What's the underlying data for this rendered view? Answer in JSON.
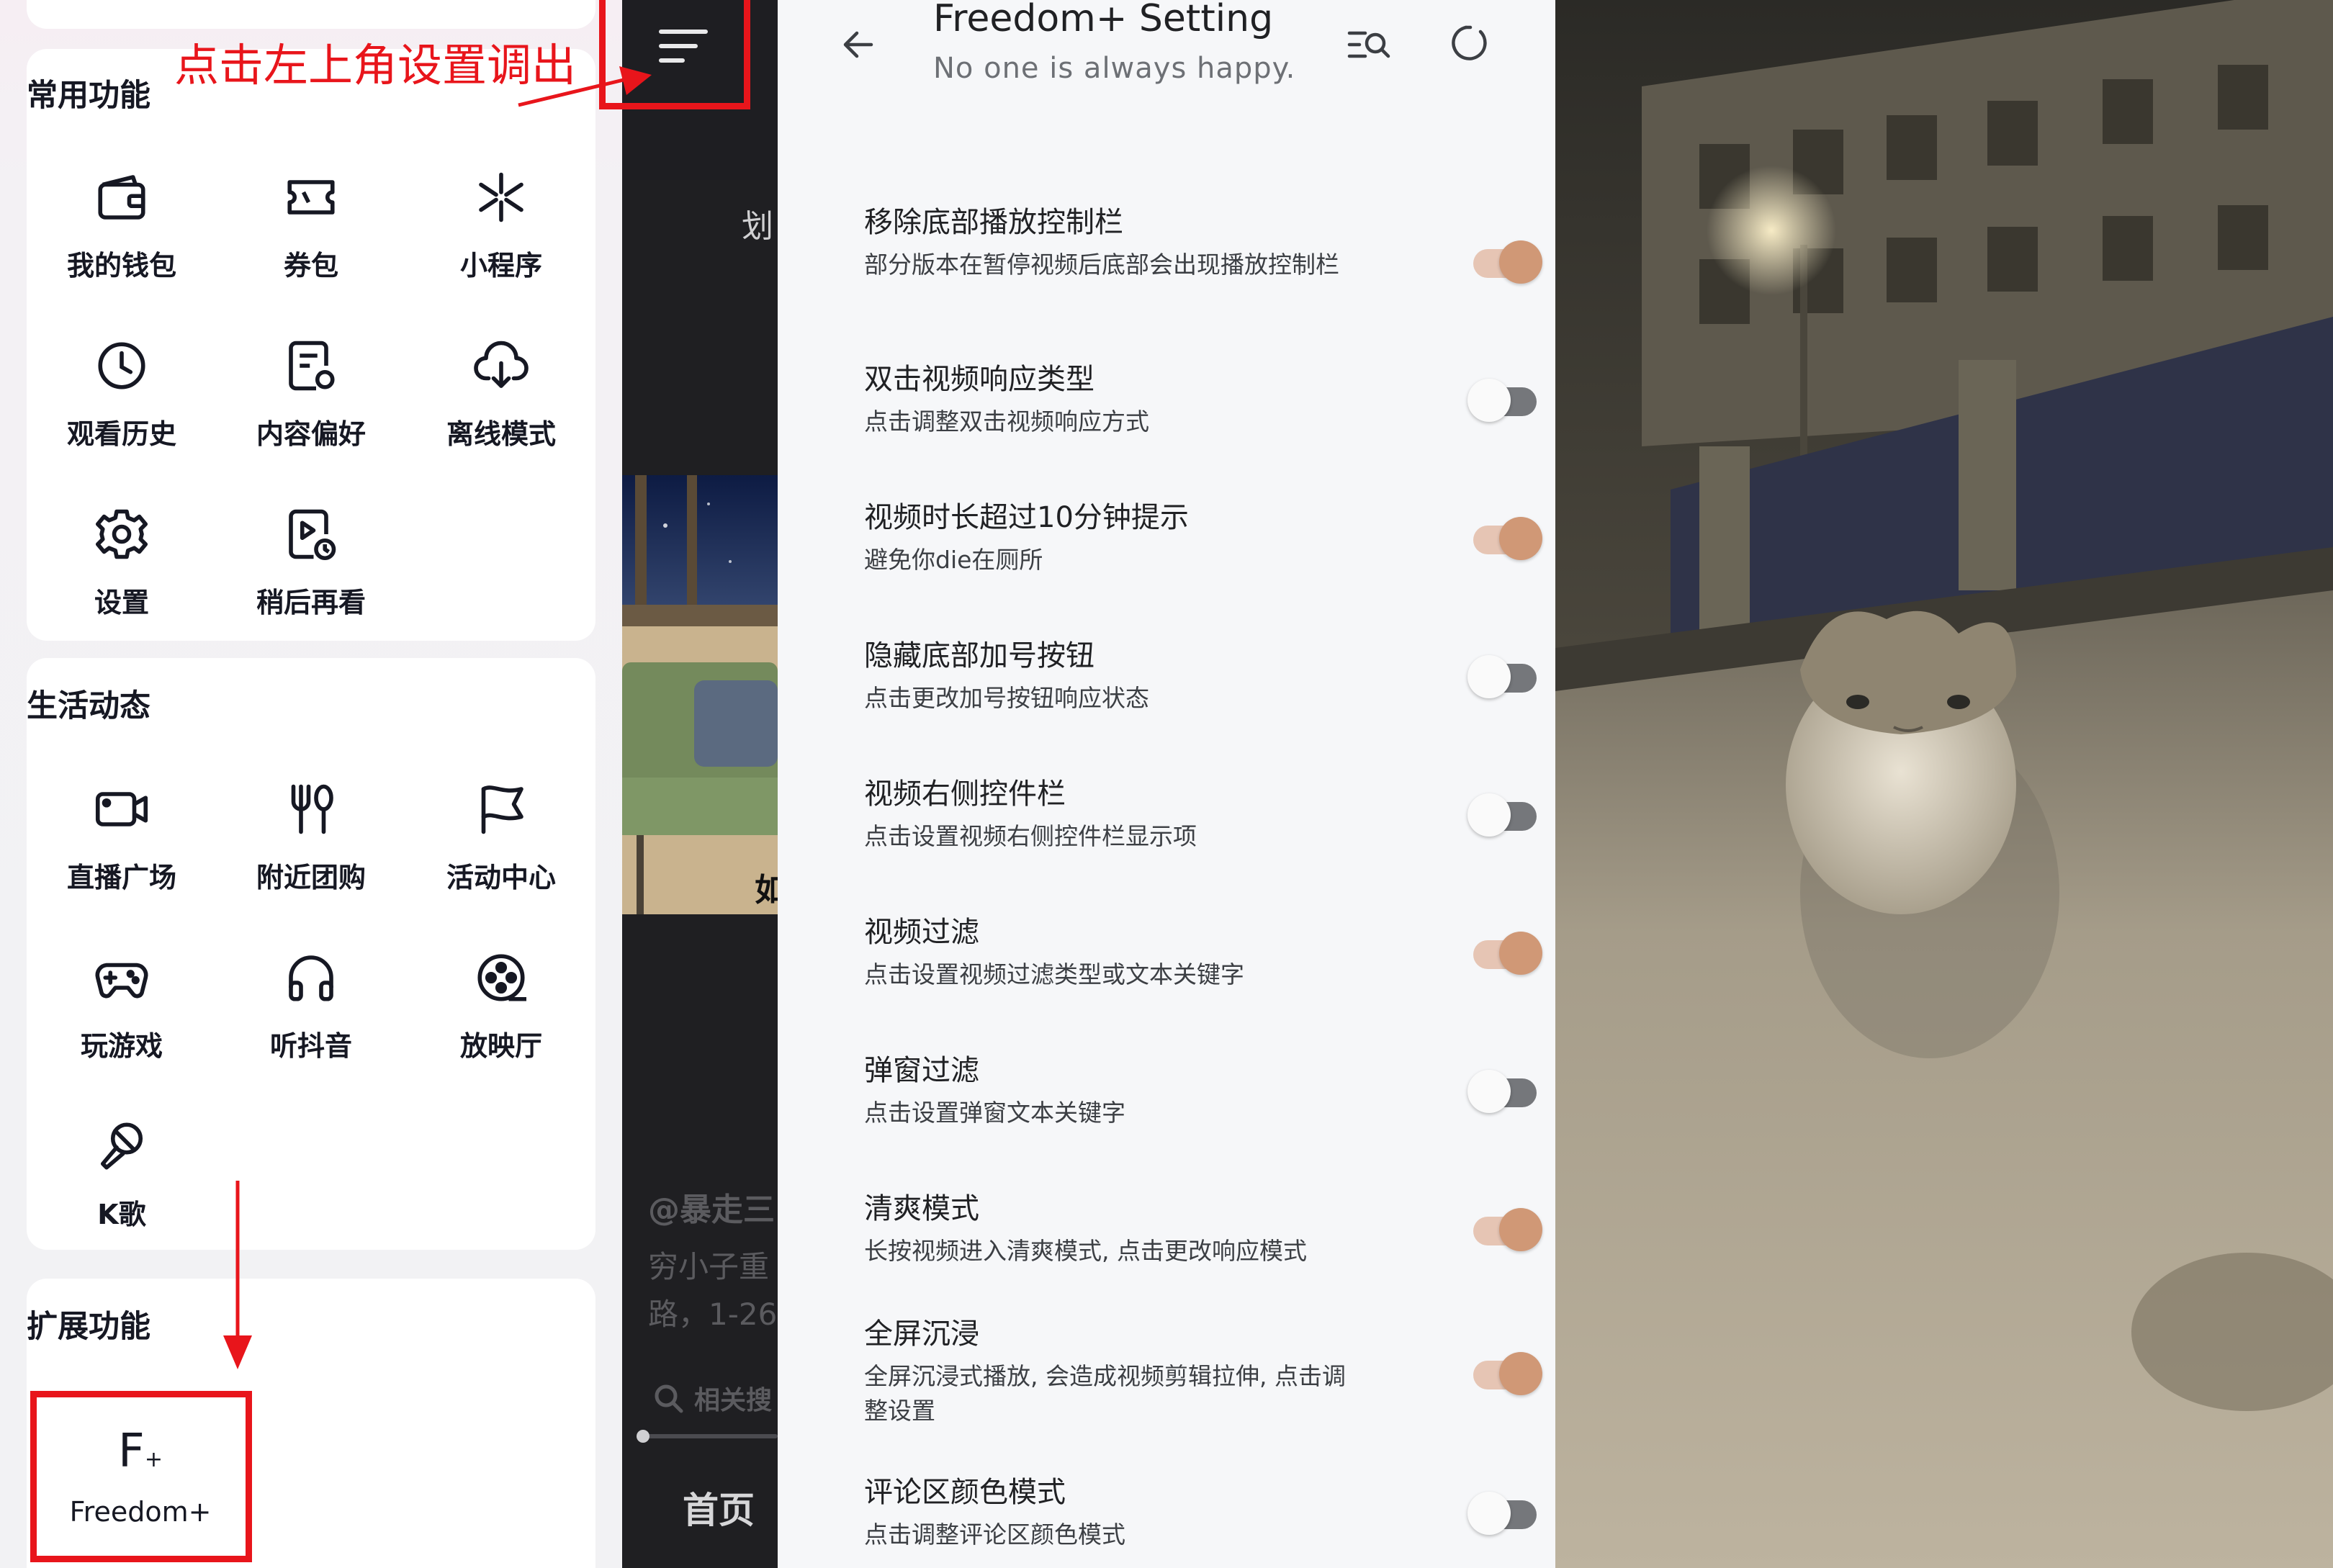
{
  "menu": {
    "sections": [
      {
        "title": "常用功能",
        "items": [
          {
            "label": "我的钱包",
            "icon": "wallet-icon"
          },
          {
            "label": "券包",
            "icon": "coupon-icon"
          },
          {
            "label": "小程序",
            "icon": "mini-program-icon"
          },
          {
            "label": "观看历史",
            "icon": "clock-icon"
          },
          {
            "label": "内容偏好",
            "icon": "preference-icon"
          },
          {
            "label": "离线模式",
            "icon": "cloud-download-icon"
          },
          {
            "label": "设置",
            "icon": "gear-icon"
          },
          {
            "label": "稍后再看",
            "icon": "watch-later-icon"
          }
        ]
      },
      {
        "title": "生活动态",
        "items": [
          {
            "label": "直播广场",
            "icon": "live-camera-icon"
          },
          {
            "label": "附近团购",
            "icon": "fork-knife-icon"
          },
          {
            "label": "活动中心",
            "icon": "flag-icon"
          },
          {
            "label": "玩游戏",
            "icon": "gamepad-icon"
          },
          {
            "label": "听抖音",
            "icon": "headphones-icon"
          },
          {
            "label": "放映厅",
            "icon": "film-reel-icon"
          },
          {
            "label": "K歌",
            "icon": "microphone-icon"
          }
        ]
      },
      {
        "title": "扩展功能",
        "items": [
          {
            "label": "Freedom+",
            "icon": "freedom-plus-icon"
          }
        ]
      }
    ]
  },
  "dark_panel": {
    "top_text": "划",
    "frame_text": "如",
    "author": "@暴走三",
    "desc_line1": "穷小子重",
    "desc_line2": "路，1-26",
    "search_text": "相关搜",
    "nav_home": "首页"
  },
  "settings": {
    "title": "Freedom+ Setting",
    "subtitle": "No one is always happy.",
    "colors": {
      "toggle_on": "#d09876",
      "toggle_off": "#75777b"
    },
    "items": [
      {
        "title": "移除底部播放控制栏",
        "desc": "部分版本在暂停视频后底部会出现播放控制栏",
        "enabled": true
      },
      {
        "title": "双击视频响应类型",
        "desc": "点击调整双击视频响应方式",
        "enabled": false
      },
      {
        "title": "视频时长超过10分钟提示",
        "desc": "避免你die在厕所",
        "enabled": true
      },
      {
        "title": "隐藏底部加号按钮",
        "desc": "点击更改加号按钮响应状态",
        "enabled": false
      },
      {
        "title": "视频右侧控件栏",
        "desc": "点击设置视频右侧控件栏显示项",
        "enabled": false
      },
      {
        "title": "视频过滤",
        "desc": "点击设置视频过滤类型或文本关键字",
        "enabled": true
      },
      {
        "title": "弹窗过滤",
        "desc": "点击设置弹窗文本关键字",
        "enabled": false
      },
      {
        "title": "清爽模式",
        "desc": "长按视频进入清爽模式, 点击更改响应模式",
        "enabled": true
      },
      {
        "title": "全屏沉浸",
        "desc": "全屏沉浸式播放, 会造成视频剪辑拉伸, 点击调整设置",
        "enabled": true
      },
      {
        "title": "评论区颜色模式",
        "desc": "点击调整评论区颜色模式",
        "enabled": false
      }
    ]
  },
  "annotation": {
    "text": "点击左上角设置调出",
    "color": "#e8151b"
  }
}
